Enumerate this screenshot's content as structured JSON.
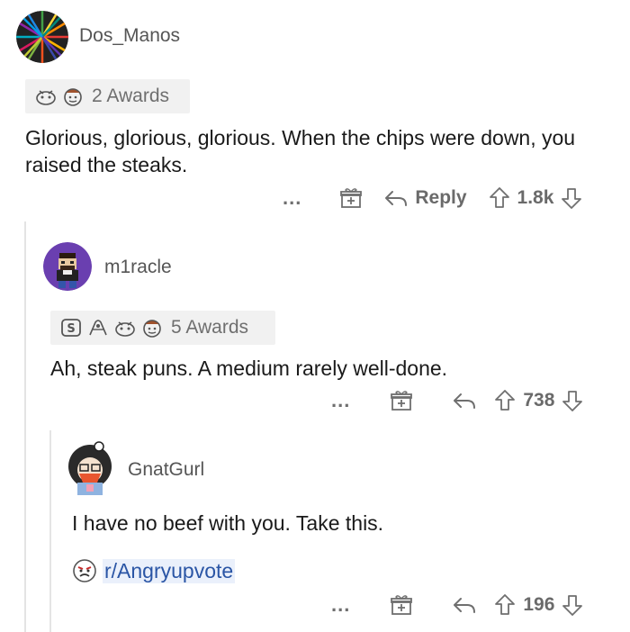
{
  "comments": [
    {
      "username": "Dos_Manos",
      "awards_label": "2 Awards",
      "text": "Glorious, glorious, glorious. When the chips were down, you raised the steaks.",
      "reply_label": "Reply",
      "score": "1.8k",
      "more": "..."
    },
    {
      "username": "m1racle",
      "awards_label": "5 Awards",
      "text": "Ah, steak puns. A medium rarely well-done.",
      "score": "738",
      "more": "..."
    },
    {
      "username": "GnatGurl",
      "text": "I have no beef with you. Take this.",
      "subreddit_link": "r/Angryupvote",
      "score": "196",
      "more": "..."
    }
  ],
  "icons": [
    "gift-award-icon",
    "reply-arrow-icon",
    "upvote-icon",
    "downvote-icon",
    "award-icon"
  ],
  "colors": {
    "link": "#2a55a5",
    "meta": "#7a7a7a",
    "award_bg": "#f1f1f1"
  }
}
